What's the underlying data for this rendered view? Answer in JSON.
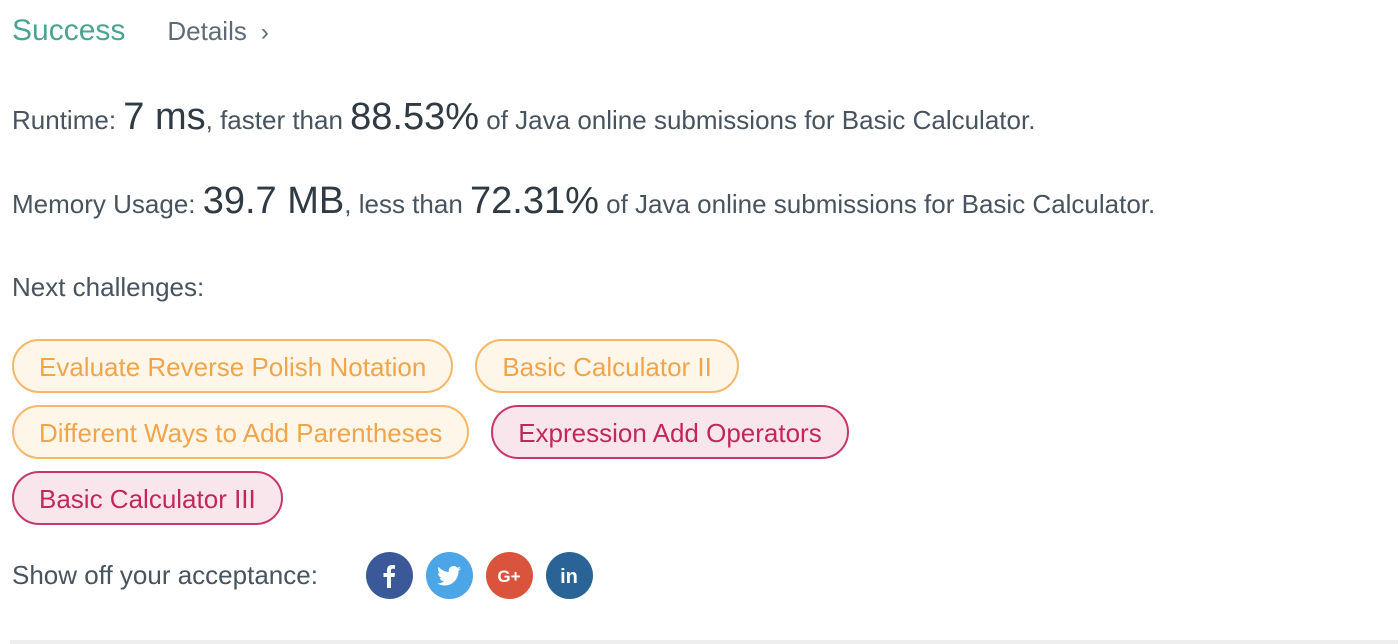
{
  "header": {
    "status": "Success",
    "details_label": "Details",
    "chevron": "›"
  },
  "runtime": {
    "label": "Runtime: ",
    "value": "7 ms",
    "mid": ", faster than ",
    "percent": "88.53%",
    "suffix": " of Java online submissions for Basic Calculator."
  },
  "memory": {
    "label": "Memory Usage: ",
    "value": "39.7 MB",
    "mid": ", less than ",
    "percent": "72.31%",
    "suffix": " of Java online submissions for Basic Calculator."
  },
  "next": {
    "title": "Next challenges:",
    "challenges": [
      {
        "label": "Evaluate Reverse Polish Notation",
        "difficulty": "medium"
      },
      {
        "label": "Basic Calculator II",
        "difficulty": "medium"
      },
      {
        "label": "Different Ways to Add Parentheses",
        "difficulty": "medium"
      },
      {
        "label": "Expression Add Operators",
        "difficulty": "hard"
      },
      {
        "label": "Basic Calculator III",
        "difficulty": "hard"
      }
    ]
  },
  "share": {
    "label": "Show off your acceptance:",
    "networks": [
      {
        "icon": "facebook-icon",
        "glyph": "f",
        "color": "#3b5998"
      },
      {
        "icon": "twitter-icon",
        "color": "#4ba5e6"
      },
      {
        "icon": "google-plus-icon",
        "glyph": "G+",
        "color": "#d9533d"
      },
      {
        "icon": "linkedin-icon",
        "glyph": "in",
        "color": "#2a6496"
      }
    ]
  },
  "colors": {
    "success": "#4aa394",
    "medium": "#f0a54a",
    "hard": "#c2275b"
  }
}
